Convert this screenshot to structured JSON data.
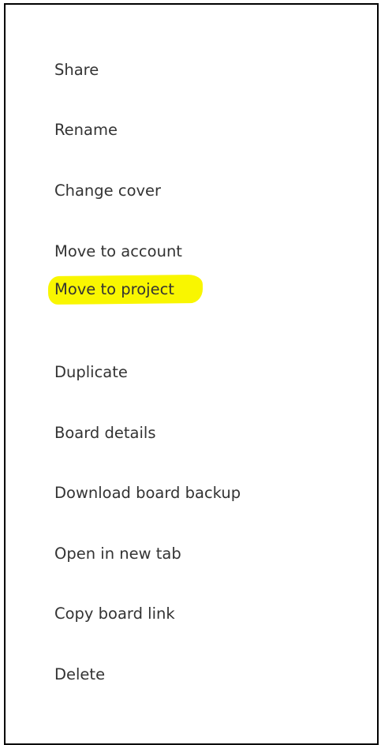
{
  "menu": {
    "items": [
      {
        "label": "Share"
      },
      {
        "label": "Rename"
      },
      {
        "label": "Change cover"
      },
      {
        "label": "Move to account"
      },
      {
        "label": "Move to project"
      },
      {
        "label": "Duplicate"
      },
      {
        "label": "Board details"
      },
      {
        "label": "Download board backup"
      },
      {
        "label": "Open in new tab"
      },
      {
        "label": "Copy board link"
      },
      {
        "label": "Delete"
      }
    ],
    "highlighted_item": "Move to project",
    "highlight_color": "#f9f600",
    "text_color": "#333333"
  }
}
